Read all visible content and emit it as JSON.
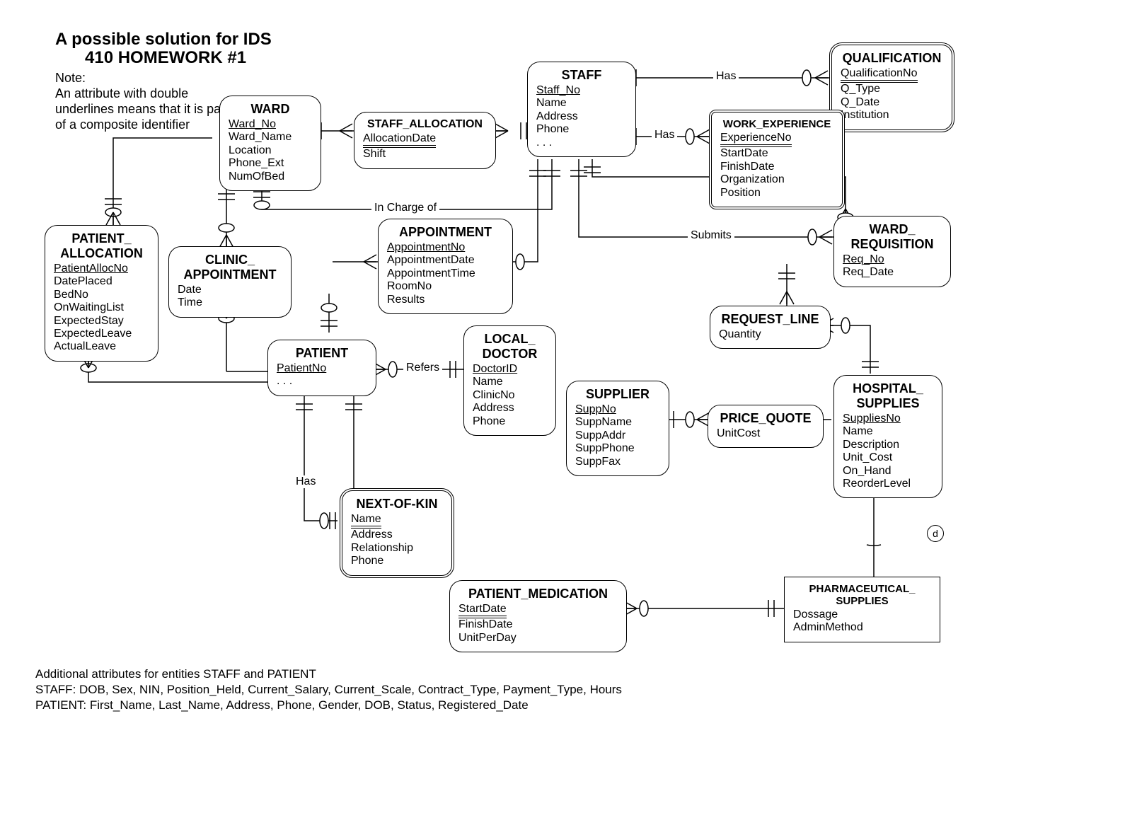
{
  "title_line1": "A possible solution for IDS",
  "title_line2": "410 HOMEWORK #1",
  "note_line1": "Note:",
  "note_line2": "An attribute with double",
  "note_line3": "underlines  means that it is part",
  "note_line4": "of a composite identifier",
  "rel": {
    "has1": "Has",
    "has2": "Has",
    "has3": "Has",
    "incharge": "In Charge of",
    "submits": "Submits",
    "refers": "Refers",
    "d": "d"
  },
  "e": {
    "ward": {
      "name": "WARD",
      "a1": "Ward_No",
      "a2": "Ward_Name",
      "a3": "Location",
      "a4": "Phone_Ext",
      "a5": "NumOfBed"
    },
    "staff": {
      "name": "STAFF",
      "a1": "Staff_No",
      "a2": "Name",
      "a3": "Address",
      "a4": "Phone",
      "a5": ". . ."
    },
    "qual": {
      "name": "QUALIFICATION",
      "a1": "QualificationNo",
      "a2": "Q_Type",
      "a3": "Q_Date",
      "a4": "Institution"
    },
    "work": {
      "name": "WORK_EXPERIENCE",
      "a1": "ExperienceNo",
      "a2": "StartDate",
      "a3": "FinishDate",
      "a4": "Organization",
      "a5": "Position"
    },
    "salloc": {
      "name": "STAFF_ALLOCATION",
      "a1": "AllocationDate",
      "a2": "Shift"
    },
    "palloc": {
      "name": "PATIENT_ ALLOCATION",
      "a1": "PatientAllocNo",
      "a2": "DatePlaced",
      "a3": "BedNo",
      "a4": "OnWaitingList",
      "a5": "ExpectedStay",
      "a6": "ExpectedLeave",
      "a7": "ActualLeave"
    },
    "clinic": {
      "name": "CLINIC_ APPOINTMENT",
      "a1": "Date",
      "a2": "Time"
    },
    "appoint": {
      "name": "APPOINTMENT",
      "a1": "AppointmentNo",
      "a2": "AppointmentDate",
      "a3": "AppointmentTime",
      "a4": "RoomNo",
      "a5": "Results"
    },
    "patient": {
      "name": "PATIENT",
      "a1": "PatientNo",
      "a2": ". . ."
    },
    "doctor": {
      "name": "LOCAL_ DOCTOR",
      "a1": "DoctorID",
      "a2": "Name",
      "a3": "ClinicNo",
      "a4": "Address",
      "a5": "Phone"
    },
    "kin": {
      "name": "NEXT-OF-KIN",
      "a1": "Name",
      "a2": "Address",
      "a3": "Relationship",
      "a4": "Phone"
    },
    "supplier": {
      "name": "SUPPLIER",
      "a1": "SuppNo",
      "a2": "SuppName",
      "a3": "SuppAddr",
      "a4": "SuppPhone",
      "a5": "SuppFax"
    },
    "price": {
      "name": "PRICE_QUOTE",
      "a1": "UnitCost"
    },
    "wreq": {
      "name": "WARD_ REQUISITION",
      "a1": "Req_No",
      "a2": "Req_Date"
    },
    "rline": {
      "name": "REQUEST_LINE",
      "a1": "Quantity"
    },
    "supplies": {
      "name": "HOSPITAL_ SUPPLIES",
      "a1": "SuppliesNo",
      "a2": "Name",
      "a3": "Description",
      "a4": "Unit_Cost",
      "a5": "On_Hand",
      "a6": "ReorderLevel"
    },
    "pmed": {
      "name": "PATIENT_MEDICATION",
      "a1": "StartDate",
      "a2": "FinishDate",
      "a3": "UnitPerDay"
    },
    "pharma": {
      "name": "PHARMACEUTICAL_ SUPPLIES",
      "a1": "Dossage",
      "a2": "AdminMethod"
    }
  },
  "footer": {
    "l1": "Additional attributes for entities STAFF and PATIENT",
    "l2": "STAFF: DOB, Sex, NIN, Position_Held, Current_Salary, Current_Scale, Contract_Type, Payment_Type, Hours",
    "l3": "PATIENT: First_Name, Last_Name, Address, Phone, Gender, DOB, Status, Registered_Date"
  }
}
